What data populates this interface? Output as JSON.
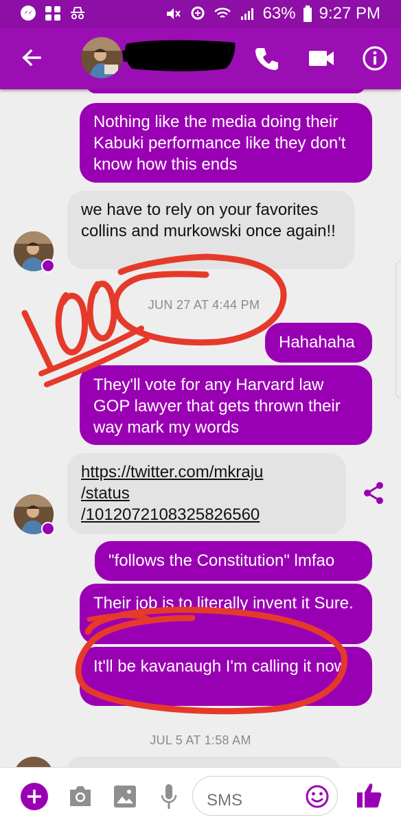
{
  "status_bar": {
    "battery": "63%",
    "time": "9:27 PM"
  },
  "header": {
    "back_icon": "arrow-left",
    "call_icon": "phone",
    "video_icon": "video-camera",
    "info_icon": "info-circle"
  },
  "messages": [
    {
      "dir": "out",
      "text": "Nothing like the media doing their Kabuki performance like they don't know how this ends"
    },
    {
      "dir": "in",
      "text": "we have to rely on your favorites collins and murkowski once again!!"
    },
    {
      "type": "timestamp",
      "text": "JUN 27 AT 4:44 PM"
    },
    {
      "dir": "out",
      "text": "Hahahaha"
    },
    {
      "dir": "out",
      "text": "They'll vote for any Harvard law GOP lawyer that gets thrown their way mark my words"
    },
    {
      "dir": "in",
      "text": "https://twitter.com/mkraju/status/1012072108325826560",
      "lines": [
        "https://twitter.com/mkraju",
        "/status",
        "/1012072108325826560"
      ]
    },
    {
      "dir": "out",
      "text": "\"follows the Constitution\" lmfao"
    },
    {
      "dir": "out",
      "text": "Their job is to literally invent it Sure."
    },
    {
      "dir": "out",
      "text": "It'll be kavanaugh I'm calling it now"
    },
    {
      "type": "timestamp",
      "text": "JUL 5 AT 1:58 AM"
    }
  ],
  "composer": {
    "placeholder": "SMS"
  },
  "annotation": {
    "handwritten": "100"
  },
  "colors": {
    "header": "#9b0eb3",
    "outgoing_bubble": "#9a00b3",
    "incoming_bubble": "#e3e3e3",
    "doodle_red": "#e53a2b"
  }
}
